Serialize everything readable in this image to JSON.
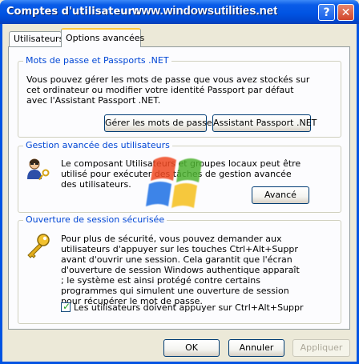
{
  "window": {
    "title": "Comptes d'utilisateurs",
    "watermark": "www.windowsutilities.net",
    "help_glyph": "?",
    "close_glyph": "✕"
  },
  "tabs": [
    {
      "label": "Utilisateurs",
      "active": false
    },
    {
      "label": "Options avancées",
      "active": true
    }
  ],
  "passwords": {
    "title": "Mots de passe et Passports .NET",
    "description": "Vous pouvez gérer les mots de passe que vous avez stockés sur cet ordinateur ou modifier votre identité Passport par défaut avec l'Assistant Passport .NET.",
    "manage_button": "Gérer les mots de passe",
    "passport_button": "Assistant Passport .NET"
  },
  "advanced_users": {
    "title": "Gestion avancée des utilisateurs",
    "description": "Le composant Utilisateurs et groupes locaux peut être utilisé pour exécuter des tâches de gestion avancée des utilisateurs.",
    "advanced_button": "Avancé"
  },
  "secure_logon": {
    "title": "Ouverture de session sécurisée",
    "description": "Pour plus de sécurité, vous pouvez demander aux utilisateurs d'appuyer sur les touches Ctrl+Alt+Suppr avant d'ouvrir une session. Cela garantit que l'écran d'ouverture de session Windows authentique apparaît ; le système est ainsi protégé contre certains programmes qui simulent une ouverture de session pour récupérer le mot de passe.",
    "checkbox_label": "Les utilisateurs doivent appuyer sur Ctrl+Alt+Suppr",
    "checkbox_checked": true
  },
  "footer": {
    "ok": "OK",
    "cancel": "Annuler",
    "apply": "Appliquer"
  },
  "colors": {
    "title_bar": "#0054e3",
    "group_title": "#0046d5",
    "background": "#ece9d8"
  }
}
